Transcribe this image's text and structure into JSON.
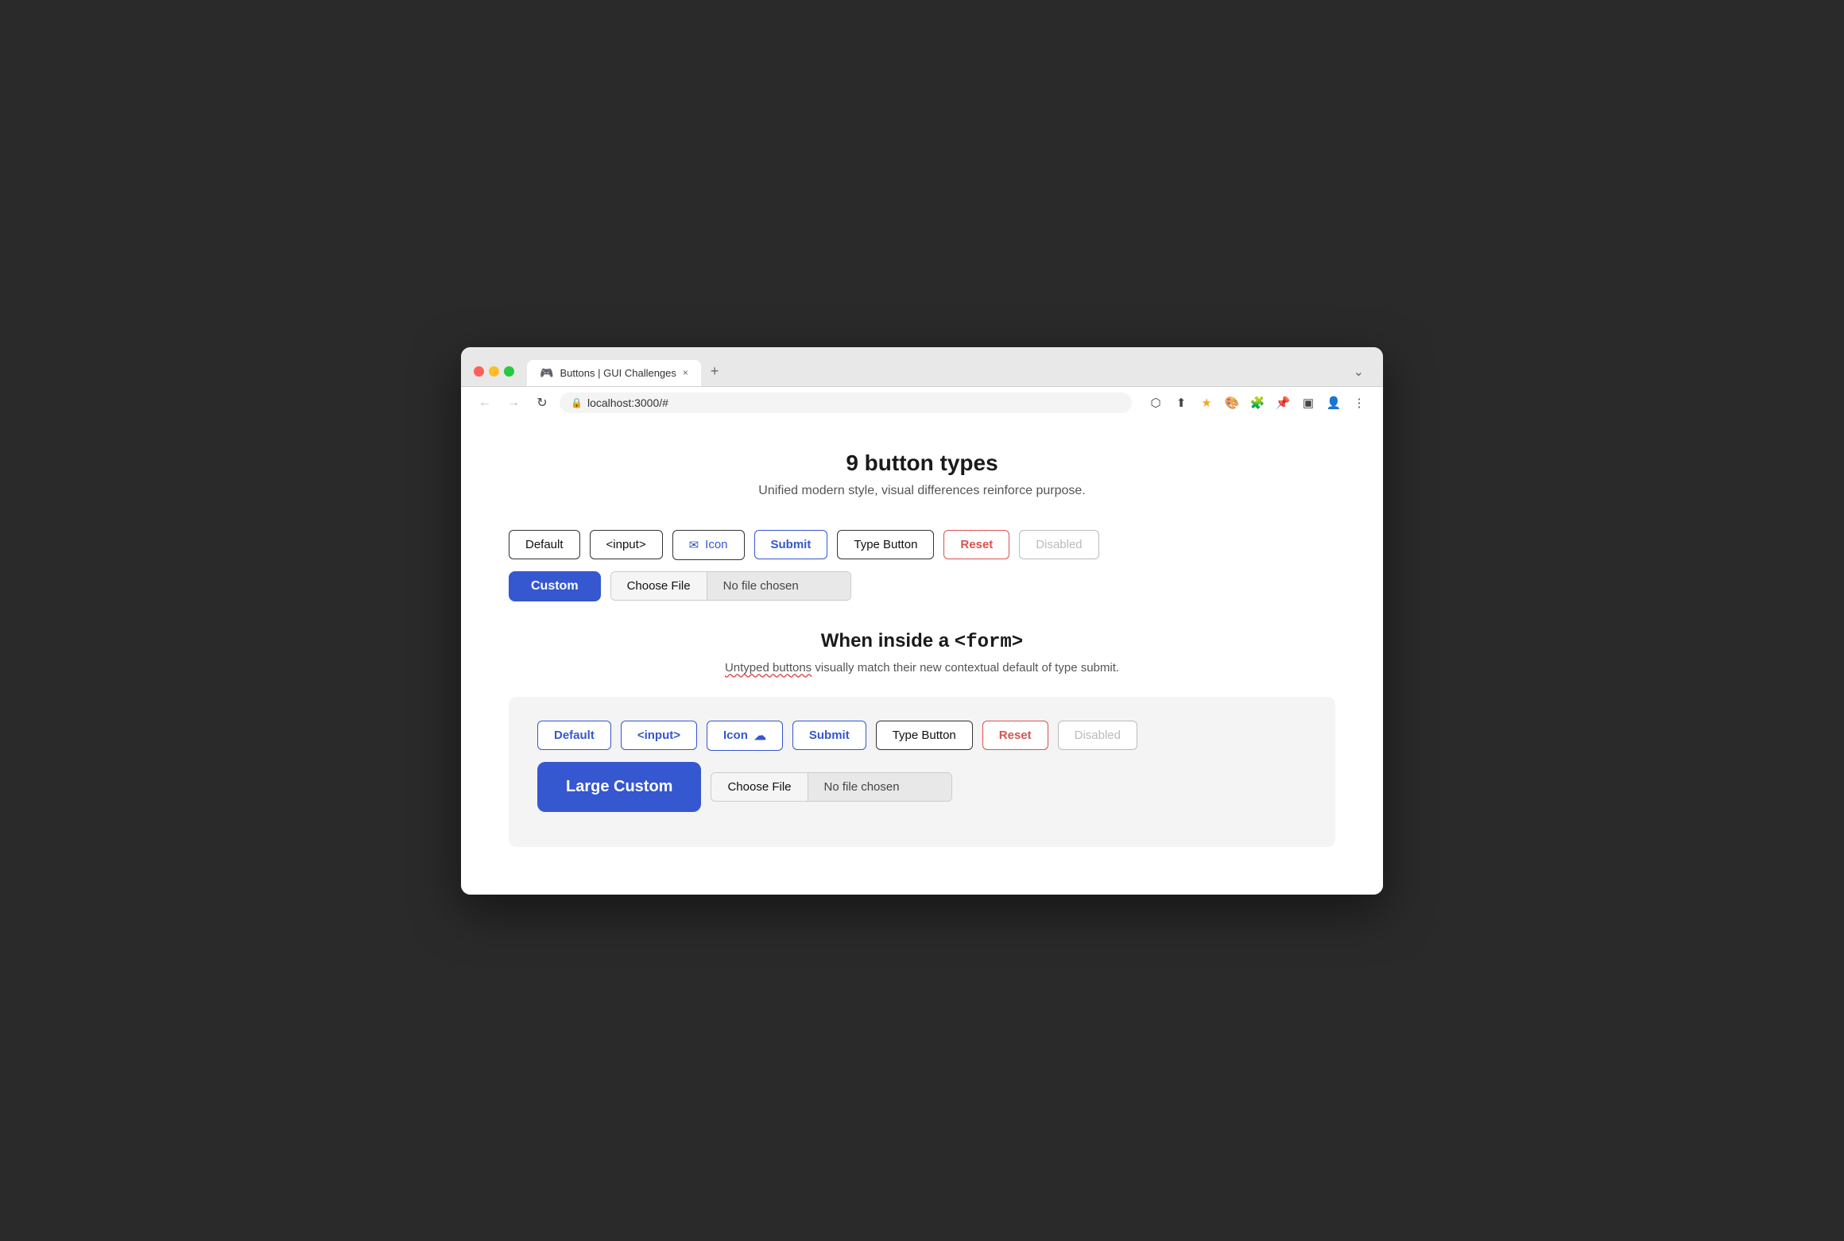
{
  "browser": {
    "tab_title": "Buttons | GUI Challenges",
    "url": "localhost:3000/#",
    "tab_icon": "🎮"
  },
  "page": {
    "title": "9 button types",
    "subtitle": "Unified modern style, visual differences reinforce purpose.",
    "section2_title": "When inside a ",
    "section2_title_code": "<form>",
    "section2_subtitle_part1": "Untyped buttons",
    "section2_subtitle_part2": " visually match their new contextual default of type submit."
  },
  "buttons_row1": [
    {
      "label": "Default",
      "type": "default"
    },
    {
      "label": "<input>",
      "type": "input"
    },
    {
      "label": "Icon",
      "type": "icon"
    },
    {
      "label": "Submit",
      "type": "submit"
    },
    {
      "label": "Type Button",
      "type": "type-button"
    },
    {
      "label": "Reset",
      "type": "reset"
    },
    {
      "label": "Disabled",
      "type": "disabled"
    }
  ],
  "buttons_row2": {
    "custom_label": "Custom",
    "file_choose_label": "Choose File",
    "file_no_chosen": "No file chosen"
  },
  "form_buttons_row1": [
    {
      "label": "Default",
      "type": "default-blue"
    },
    {
      "label": "<input>",
      "type": "input-blue"
    },
    {
      "label": "Icon",
      "type": "icon-blue"
    },
    {
      "label": "Submit",
      "type": "submit"
    },
    {
      "label": "Type Button",
      "type": "type-button"
    },
    {
      "label": "Reset",
      "type": "reset"
    },
    {
      "label": "Disabled",
      "type": "disabled"
    }
  ],
  "form_buttons_row2": {
    "large_custom_label": "Large Custom",
    "file_choose_label": "Choose File",
    "file_no_chosen": "No file chosen"
  },
  "icons": {
    "email": "✉",
    "cloud": "☁",
    "back_arrow": "←",
    "forward_arrow": "→",
    "reload": "↻",
    "lock": "🔒",
    "external_link": "⬡",
    "share": "⬆",
    "star": "★",
    "puzzle": "🧩",
    "pin": "📌",
    "sidebar": "▣",
    "person": "👤",
    "more": "⋮",
    "chevron_down": "⌄",
    "close": "×",
    "new_tab": "+"
  }
}
